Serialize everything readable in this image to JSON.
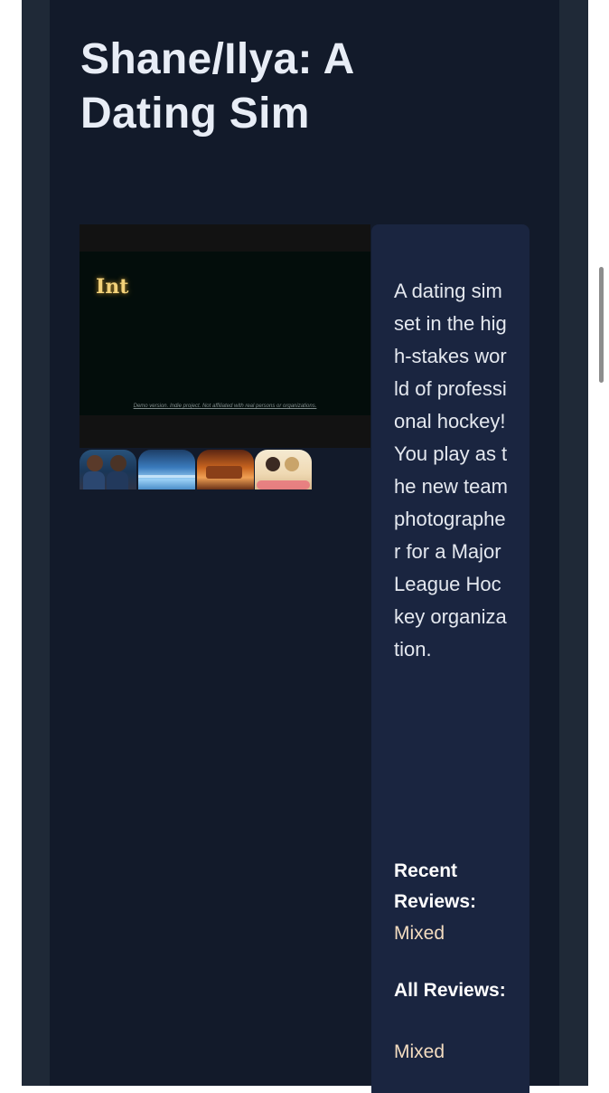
{
  "page": {
    "title": " Shane/Ilya: A Dating Sim"
  },
  "media": {
    "screen_text": "Int",
    "disclaimer": "Demo version. Indie project. Not affiliated with real persons or organizations.",
    "thumbnails": [
      {
        "name": "thumbnail-1"
      },
      {
        "name": "thumbnail-2"
      },
      {
        "name": "thumbnail-3"
      },
      {
        "name": "thumbnail-4"
      }
    ]
  },
  "info": {
    "description": "A dating sim set in the high-stakes world of professional hockey! You play as the new team photographer for a Major League Hockey organization.",
    "recent_reviews_label": "Recent Reviews:",
    "recent_reviews_value": "Mixed",
    "all_reviews_label": "All Reviews:",
    "all_reviews_value": "Mixed"
  },
  "colors": {
    "background": "#1f2937",
    "content": "#121a2a",
    "panel": "#1a2540",
    "review_value": "#f3dcc0"
  }
}
